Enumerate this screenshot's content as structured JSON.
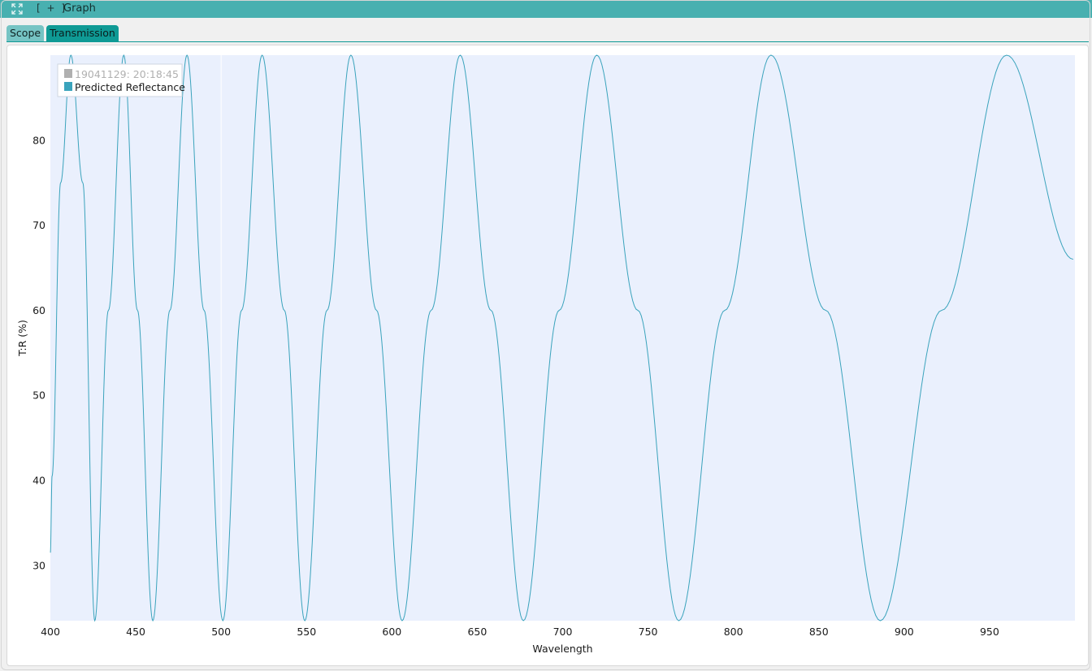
{
  "window": {
    "title": "Graph",
    "expand_icon": "expand-icon",
    "plus_label": "[ + ]"
  },
  "tabs": [
    {
      "label": "Scope",
      "active": false
    },
    {
      "label": "Transmission",
      "active": true
    }
  ],
  "colors": {
    "titlebar": "#48b0b0",
    "accent": "#0f9a95",
    "plot_bg": "#eaf0fd",
    "series": "#3aa3bc",
    "legend_inactive": "#b0b0b0"
  },
  "chart_data": {
    "type": "line",
    "xlabel": "Wavelength",
    "ylabel": "T:R (%)",
    "xlim": [
      400,
      1000
    ],
    "ylim": [
      23.5,
      90
    ],
    "xticks": [
      400,
      450,
      500,
      550,
      600,
      650,
      700,
      750,
      800,
      850,
      900,
      950
    ],
    "yticks": [
      30,
      40,
      50,
      60,
      70,
      80
    ],
    "grid": false,
    "legend_position": "top-left",
    "legend": [
      {
        "label": "19041129:  20:18:45",
        "active": false
      },
      {
        "label": "Predicted Reflectance",
        "active": true
      }
    ],
    "series": [
      {
        "name": "Predicted Reflectance",
        "peaks": [
          412,
          443,
          480,
          524,
          576,
          640,
          720,
          822,
          960
        ],
        "troughs": [
          426,
          460,
          501,
          549,
          606,
          677,
          768,
          886
        ],
        "x": [
          400,
          401,
          406,
          412,
          419,
          426,
          434,
          443,
          451,
          460,
          470,
          480,
          490,
          501,
          512,
          524,
          537,
          549,
          562,
          576,
          591,
          606,
          623,
          640,
          658,
          677,
          698,
          720,
          744,
          768,
          795,
          822,
          854,
          886,
          922,
          960,
          999
        ],
        "y": [
          31.5,
          40.5,
          75,
          90,
          75,
          23.5,
          60,
          90,
          60,
          23.5,
          60,
          90,
          60,
          23.5,
          60,
          90,
          60,
          23.5,
          60,
          90,
          60,
          23.5,
          60,
          90,
          60,
          23.5,
          60,
          90,
          60,
          23.5,
          60,
          90,
          60,
          23.5,
          60,
          90,
          66
        ]
      }
    ]
  }
}
